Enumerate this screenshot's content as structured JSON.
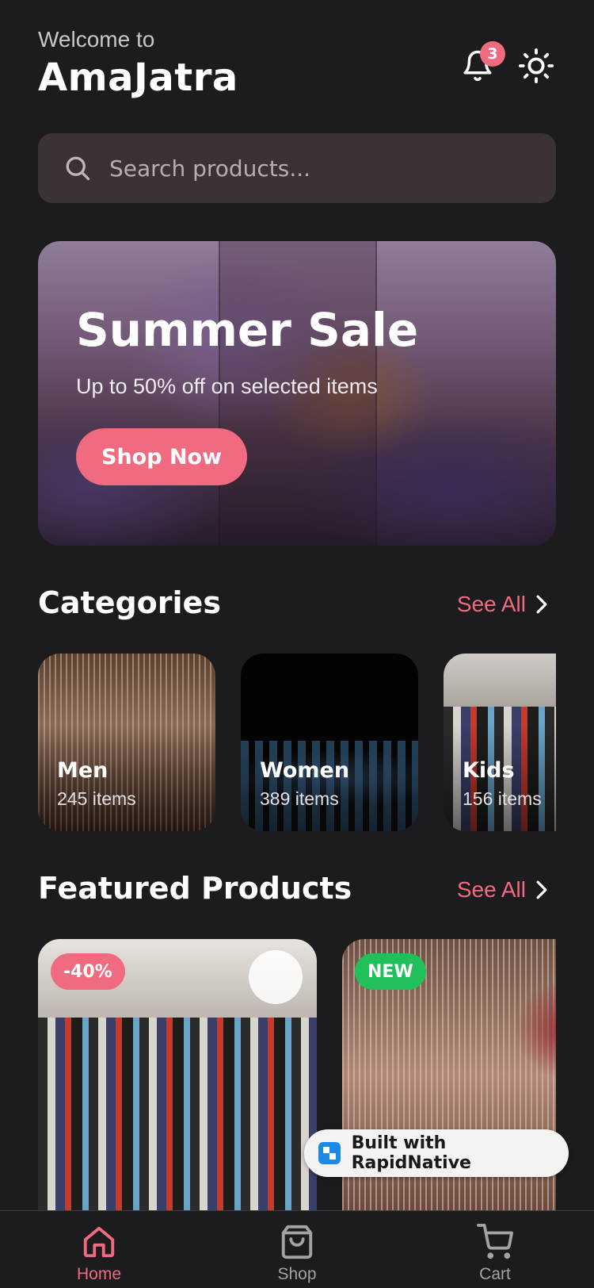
{
  "header": {
    "welcome": "Welcome to",
    "brand": "AmaJatra",
    "notification_count": "3",
    "notification_icon": "bell-icon",
    "theme_icon": "sun-icon"
  },
  "search": {
    "placeholder": "Search products...",
    "icon": "search-icon"
  },
  "hero": {
    "title": "Summer Sale",
    "subtitle": "Up to 50% off on selected items",
    "button_label": "Shop Now"
  },
  "categories": {
    "title": "Categories",
    "see_all": "See All",
    "items": [
      {
        "name": "Men",
        "count": "245 items"
      },
      {
        "name": "Women",
        "count": "389 items"
      },
      {
        "name": "Kids",
        "count": "156 items"
      }
    ]
  },
  "featured": {
    "title": "Featured Products",
    "see_all": "See All",
    "items": [
      {
        "badge": "-40%"
      },
      {
        "badge": "NEW"
      }
    ]
  },
  "rapidnative": {
    "label": "Built with RapidNative"
  },
  "tabbar": {
    "items": [
      {
        "label": "Home",
        "icon": "home-icon"
      },
      {
        "label": "Shop",
        "icon": "shopping-bag-icon"
      },
      {
        "label": "Cart",
        "icon": "cart-icon"
      }
    ]
  },
  "colors": {
    "accent": "#f06b80",
    "new_badge": "#22c05a",
    "background": "#1c1c1e",
    "search_bg": "#3a3236",
    "inactive_tab": "#a5a1a4"
  }
}
